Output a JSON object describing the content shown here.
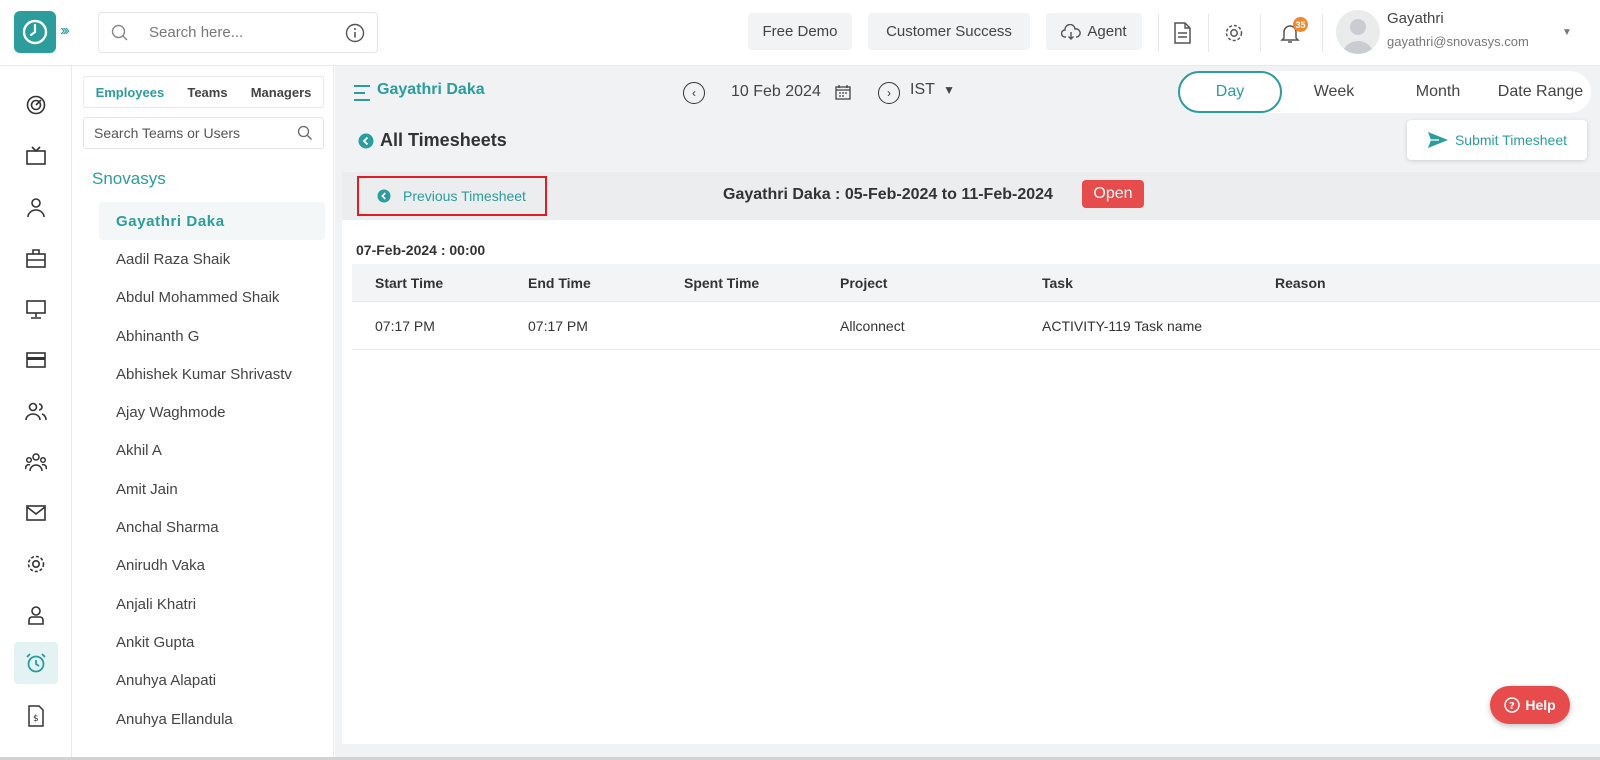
{
  "app": {
    "brand_color": "#2a9d9c"
  },
  "topbar": {
    "search_placeholder": "Search here...",
    "free_demo": "Free Demo",
    "customer_success": "Customer Success",
    "agent": "Agent",
    "notification_count": "35",
    "user_name": "Gayathri",
    "user_email": "gayathri@snovasys.com"
  },
  "employees_panel": {
    "tabs": [
      "Employees",
      "Teams",
      "Managers"
    ],
    "search_placeholder": "Search Teams or Users",
    "org_name": "Snovasys",
    "items": [
      "Gayathri Daka",
      "Aadil Raza Shaik",
      "Abdul Mohammed Shaik",
      "Abhinanth G",
      "Abhishek Kumar Shrivastv",
      "Ajay Waghmode",
      "Akhil A",
      "Amit Jain",
      "Anchal Sharma",
      "Anirudh Vaka",
      "Anjali Khatri",
      "Ankit Gupta",
      "Anuhya Alapati",
      "Anuhya Ellandula"
    ]
  },
  "main": {
    "employee_name": "Gayathri Daka",
    "date": "10 Feb 2024",
    "timezone": "IST",
    "periods": [
      "Day",
      "Week",
      "Month",
      "Date Range"
    ],
    "all_timesheets": "All Timesheets",
    "submit_timesheet": "Submit Timesheet",
    "previous_timesheet": "Previous Timesheet",
    "period_title": "Gayathri Daka : 05-Feb-2024 to 11-Feb-2024",
    "status": "Open",
    "day_header": "07-Feb-2024 : 00:00",
    "columns": [
      "Start Time",
      "End Time",
      "Spent Time",
      "Project",
      "Task",
      "Reason"
    ],
    "rows": [
      {
        "start": "07:17 PM",
        "end": "07:17 PM",
        "spent": "",
        "project": "Allconnect",
        "task": "ACTIVITY-119 Task name",
        "reason": ""
      }
    ]
  },
  "help": "Help"
}
